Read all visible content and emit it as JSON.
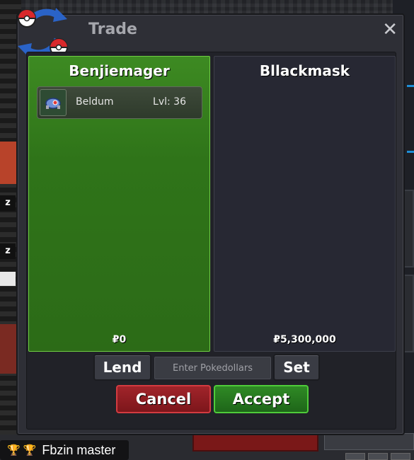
{
  "window": {
    "title": "Trade",
    "close_symbol": "✕"
  },
  "left_panel": {
    "trainer": "Benjiemager",
    "items": [
      {
        "name": "Beldum",
        "level": "Lvl: 36",
        "icon": "beldum-sprite-icon"
      }
    ],
    "money": "₽0"
  },
  "right_panel": {
    "trainer": "Bllackmask",
    "money": "₽5,300,000"
  },
  "controls": {
    "lend_label": "Lend",
    "money_placeholder": "Enter Pokedollars",
    "set_label": "Set",
    "cancel_label": "Cancel",
    "accept_label": "Accept"
  },
  "player": {
    "name": "Fbzin master",
    "badges": [
      "trophy-icon",
      "trophy-icon"
    ]
  },
  "colors": {
    "left_panel_green": "#2f7419",
    "cancel_red": "#8a1b20",
    "accept_green": "#257a1e",
    "window_bg": "#2e2f36"
  }
}
